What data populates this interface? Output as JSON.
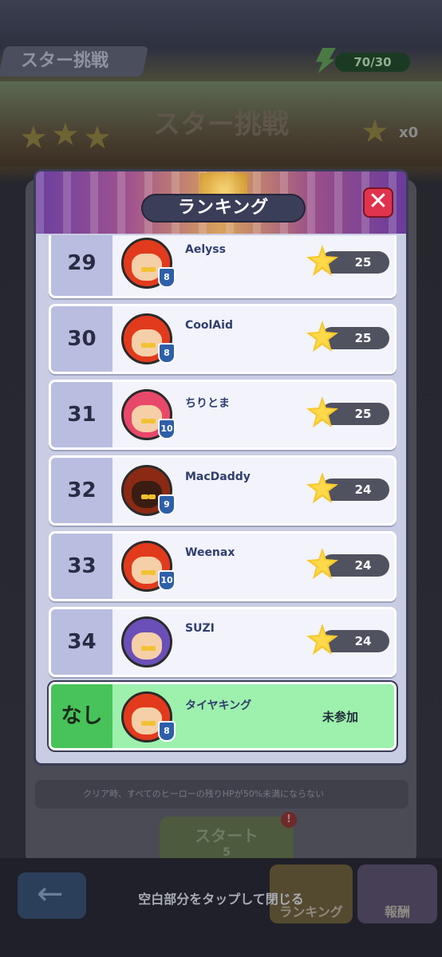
{
  "background": {
    "header_tab": "スター挑戦",
    "energy": "70/30",
    "banner_title": "スター挑戦",
    "star_count": "x0",
    "hint": "クリア時、すべてのヒーローの残りHPが50%未満にならない",
    "start_label": "スタート",
    "start_cost": "5",
    "start_badge": "!",
    "ranking_button": "ランキング",
    "reward_button": "報酬"
  },
  "modal": {
    "title": "ランキング",
    "close_label": "✕",
    "rows": [
      {
        "rank": "29",
        "name": "Aelyss",
        "level": "8",
        "score": "25",
        "hair": "#e23a1c"
      },
      {
        "rank": "30",
        "name": "CoolAid",
        "level": "8",
        "score": "25",
        "hair": "#e23a1c"
      },
      {
        "rank": "31",
        "name": "ちりとま",
        "level": "10",
        "score": "25",
        "hair": "#e8486a"
      },
      {
        "rank": "32",
        "name": "MacDaddy",
        "level": "9",
        "score": "24",
        "hair": "#8a2a14"
      },
      {
        "rank": "33",
        "name": "Weenax",
        "level": "10",
        "score": "24",
        "hair": "#e23a1c"
      },
      {
        "rank": "34",
        "name": "SUZI",
        "level": "",
        "score": "24",
        "hair": "#6a4fb8"
      }
    ],
    "my_row": {
      "rank": "なし",
      "name": "タイヤキング",
      "level": "8",
      "status": "未参加",
      "hair": "#e23a1c"
    }
  },
  "close_hint": "空白部分をタップして閉じる"
}
